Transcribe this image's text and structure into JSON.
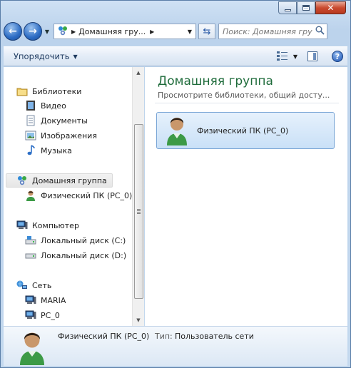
{
  "window": {
    "minimize_icon": "minimize-icon",
    "maximize_icon": "maximize-icon",
    "close_icon": "close-icon"
  },
  "nav": {
    "address_crumb": "Домашняя гру...",
    "search_placeholder": "Поиск: Домашняя группа"
  },
  "toolbar": {
    "organize_label": "Упорядочить"
  },
  "sidebar": {
    "libraries": "Библиотеки",
    "video": "Видео",
    "documents": "Документы",
    "images": "Изображения",
    "music": "Музыка",
    "homegroup": "Домашняя группа",
    "homegroup_pc": "Физический ПК (PC_0)",
    "computer": "Компьютер",
    "disk_c": "Локальный диск (C:)",
    "disk_d": "Локальный диск (D:)",
    "network": "Сеть",
    "net_maria": "MARIA",
    "net_pc0": "PC_0"
  },
  "main": {
    "title": "Домашняя группа",
    "subtitle": "Просмотрите библиотеки, общий досту...",
    "tile_name": "Физический ПК (PC_0)"
  },
  "details": {
    "name": "Физический ПК (PC_0)",
    "type_label": "Тип:",
    "type_value": "Пользователь сети"
  },
  "colors": {
    "title_green": "#1e6b3a",
    "selection_blue": "#c9e0f7"
  }
}
